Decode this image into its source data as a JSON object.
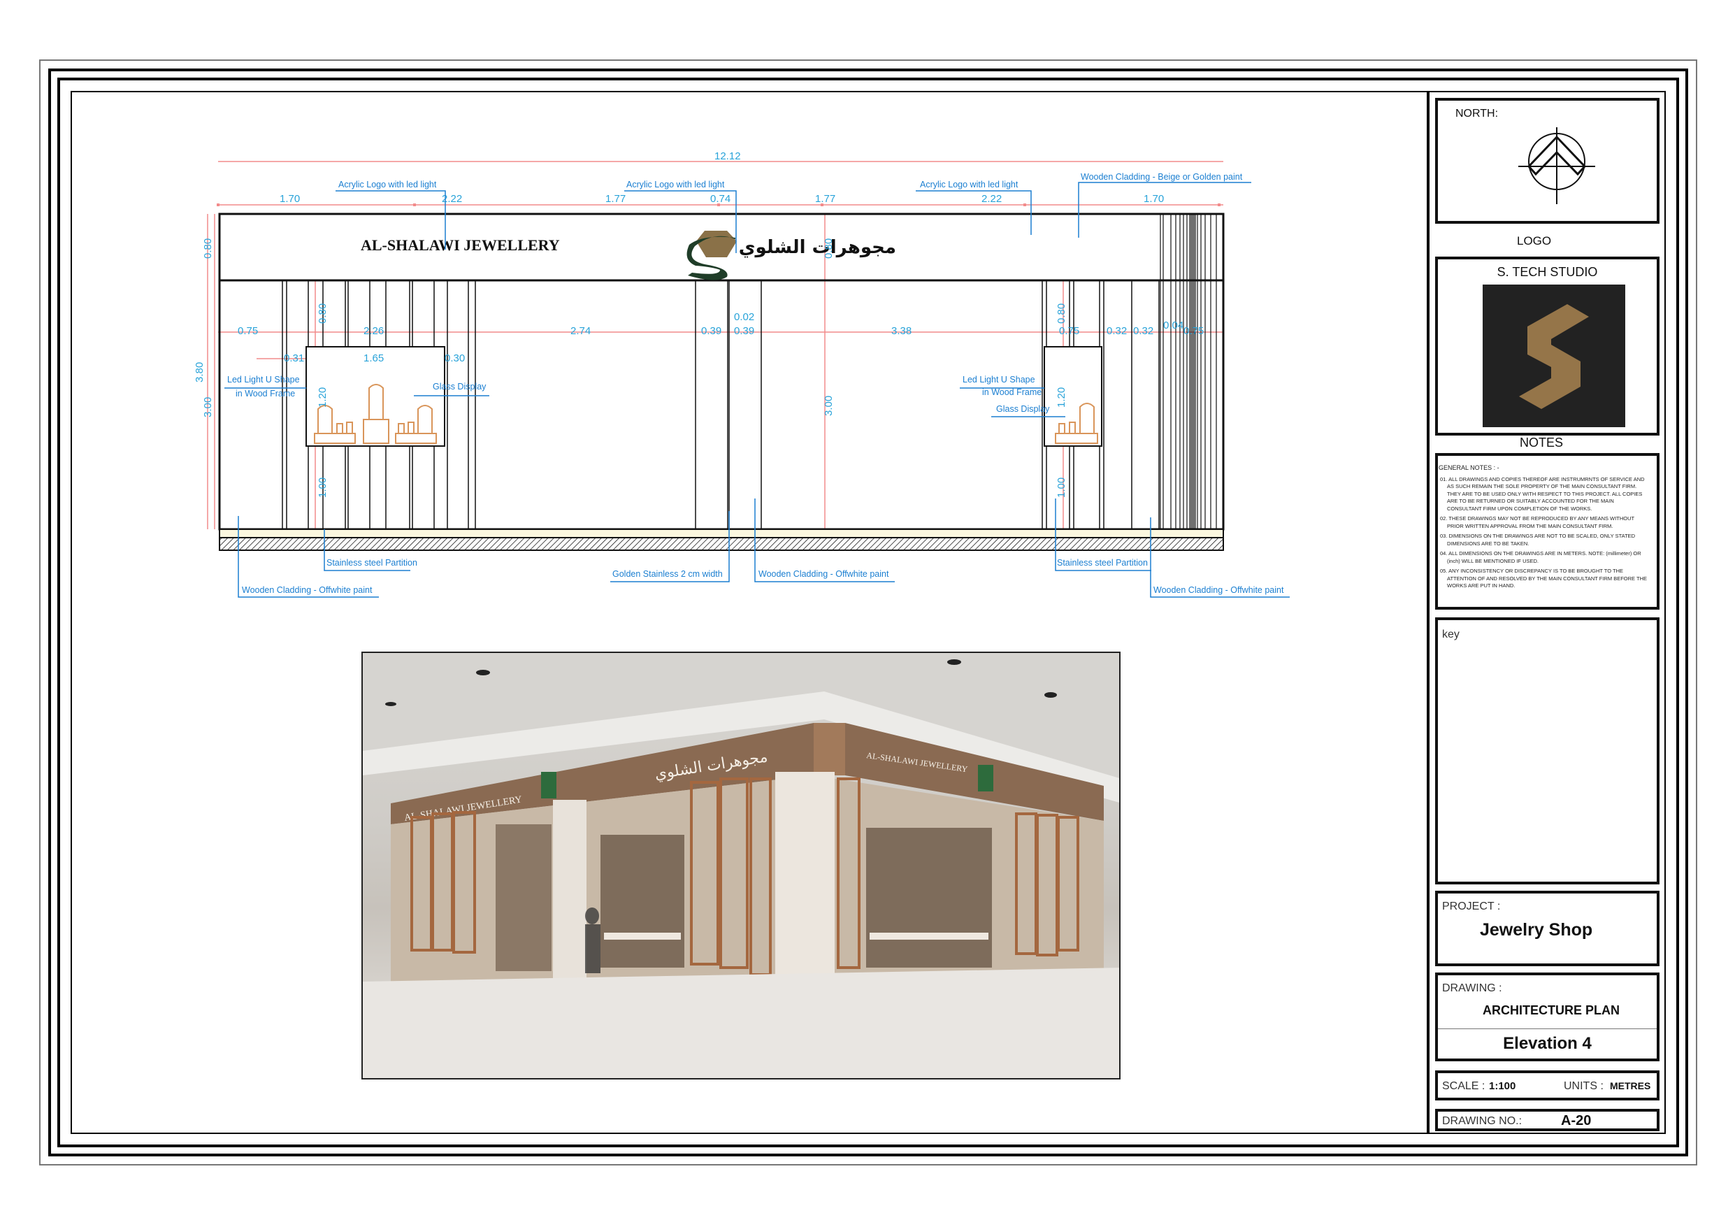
{
  "elevation": {
    "dims_top": {
      "overall": "12.12",
      "segments": [
        "1.70",
        "2.22",
        "1.77",
        "0.74",
        "1.77",
        "2.22",
        "1.70"
      ]
    },
    "dims_left": {
      "overall": "3.80",
      "fascia": "0.80",
      "lower": "3.00"
    },
    "dims_mid": [
      "0.75",
      "2.26",
      "2.74",
      "0.39",
      "0.02",
      "0.39",
      "3.38",
      "0.75",
      "0.32",
      "0.32",
      "0.04",
      "0.75"
    ],
    "dims_display_left": {
      "left": "0.31",
      "width": "1.65",
      "right": "0.30",
      "upper": "0.80",
      "display": "1.20",
      "base": "1.00"
    },
    "dims_display_right": {
      "upper": "0.80",
      "display": "1.20",
      "base": "1.00"
    },
    "dims_center_fascia": "0.80",
    "dims_center_lower": "3.00",
    "signage": {
      "english": "AL-SHALAWI JEWELLERY",
      "arabic": "مجوهرات الشلوي"
    },
    "annotations": {
      "acrylic_logo_1": "Acrylic Logo with led light",
      "acrylic_logo_2": "Acrylic Logo with led light",
      "acrylic_logo_3": "Acrylic Logo with led light",
      "wooden_cladding_beige": "Wooden Cladding - Beige or Golden paint",
      "led_light_left_1": "Led Light U Shape",
      "led_light_left_2": "in Wood Frame",
      "glass_display_left": "Glass Display",
      "led_light_right_1": "Led Light U Shape",
      "led_light_right_2": "in Wood Frame",
      "glass_display_right": "Glass Display",
      "stainless_left": "Stainless steel Partition",
      "stainless_right": "Stainless steel Partition",
      "wooden_offwhite_left": "Wooden Cladding - Offwhite paint",
      "golden_stainless": "Golden Stainless 2 cm width",
      "wooden_offwhite_center": "Wooden Cladding - Offwhite paint",
      "wooden_offwhite_right": "Wooden Cladding - Offwhite paint"
    }
  },
  "rendering": {
    "sign_english": "AL-SHALAWI JEWELLERY",
    "sign_arabic": "مجوهرات الشلوي"
  },
  "title_block": {
    "north_label": "NORTH:",
    "logo_label": "LOGO",
    "studio_name": "S. TECH STUDIO",
    "notes_label": "NOTES",
    "general_notes_title": "GENERAL NOTES : -",
    "general_notes": [
      "01. ALL DRAWINGS AND COPIES THEREOF ARE INSTRUMRNTS OF SERVICE AND AS SUCH REMAIN THE SOLE PROPERTY OF THE MAIN CONSULTANT FIRM. THEY ARE TO BE USED ONLY WITH RESPECT TO THIS PROJECT. ALL COPIES ARE TO BE RETURNED OR SUITABLY ACCOUNTED FOR THE MAIN CONSULTANT FIRM UPON COMPLETION OF THE WORKS.",
      "02. THESE DRAWINGS MAY NOT BE REPRODUCED BY ANY MEANS WITHOUT PRIOR WRITTEN APPROVAL FROM THE MAIN CONSULTANT FIRM.",
      "03. DIMENSIONS ON THE DRAWINGS ARE NOT TO BE SCALED, ONLY STATED DIMENSIONS ARE TO BE TAKEN.",
      "04. ALL DIMENSIONS ON THE DRAWINGS ARE IN METERS. NOTE: (millimeter) OR (inch) WILL BE MENTIONED IF USED.",
      "05. ANY INCONSISTENCY OR DISCREPANCY IS TO BE BROUGHT TO THE ATTENTION OF AND RESOLVED BY THE MAIN CONSULTANT FIRM BEFORE THE WORKS ARE PUT IN HAND."
    ],
    "key_label": "key",
    "project_label": "PROJECT :",
    "project_name": "Jewelry Shop",
    "drawing_label": "DRAWING :",
    "drawing_type": "ARCHITECTURE PLAN",
    "drawing_title": "Elevation 4",
    "scale_label": "SCALE :",
    "scale_value": "1:100",
    "units_label": "UNITS :",
    "units_value": "METRES",
    "drawing_no_label": "DRAWING NO.:",
    "drawing_no_value": "A-20"
  },
  "colors": {
    "dimension_line": "#f28b8b",
    "dimension_text": "#29a3d9",
    "annotation": "#1b7fd1",
    "display_fixture": "#d9955a",
    "logo_green": "#1f3d28",
    "logo_gold": "#8a7148",
    "studio_bg": "#222222",
    "studio_gold": "#957549"
  }
}
